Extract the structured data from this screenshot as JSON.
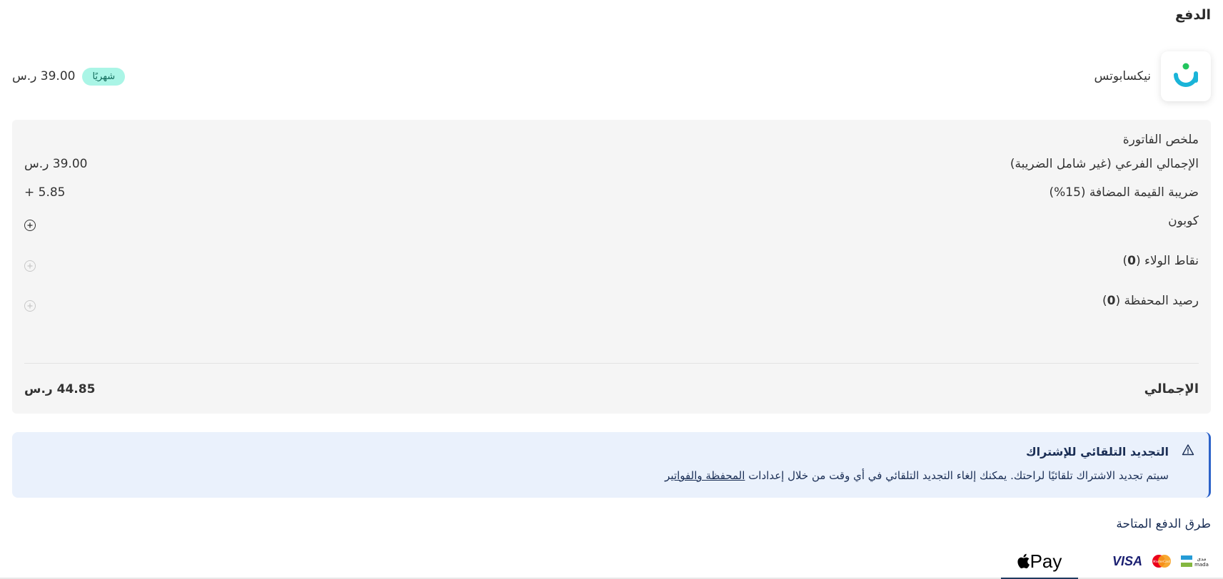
{
  "page": {
    "title": "الدفع"
  },
  "product": {
    "name": "نيكسابوتس",
    "logo_icon": "nixabots-logo-icon",
    "billing_period": "شهريًا",
    "price": "39.00 ر.س"
  },
  "summary": {
    "title": "ملخص الفاتورة",
    "subtotal_label": "الإجمالي الفرعي (غير شامل الضريبة)",
    "subtotal_value": "39.00 ر.س",
    "vat_label": "ضريبة القيمة المضافة (15%)",
    "vat_value": "+ 5.85",
    "coupon_label": "كوبون",
    "loyalty_label": "نقاط الولاء (",
    "loyalty_count": "0",
    "wallet_label": "رصيد المحفظة (",
    "wallet_count": "0",
    "paren_close": ")",
    "total_label": "الإجمالي",
    "total_value": "44.85 ر.س"
  },
  "banner": {
    "icon": "warning-icon",
    "title": "التجديد التلقائي للإشتراك",
    "text": "سيتم تجديد الاشتراك تلقائيًا لراحتك. يمكنك إلغاء التجديد التلقائي في أي وقت من خلال إعدادات ",
    "link": "المحفظة والفواتير"
  },
  "payment": {
    "methods_title": "طرق الدفع المتاحة",
    "card_logos": [
      "mada",
      "mastercard",
      "VISA"
    ],
    "visa_text": "VISA",
    "mada_text_ar": "مدى",
    "mada_text_en": "mada",
    "mastercard_text": "MasterCard",
    "applepay_text": "Pay"
  },
  "colors": {
    "accent": "#2c62c9",
    "badge_bg": "#aaf5e6",
    "summary_bg": "#f5f5f5",
    "banner_bg": "#eaf1fc",
    "logo_cyan": "#1ab4d8",
    "logo_green": "#22c55e"
  }
}
